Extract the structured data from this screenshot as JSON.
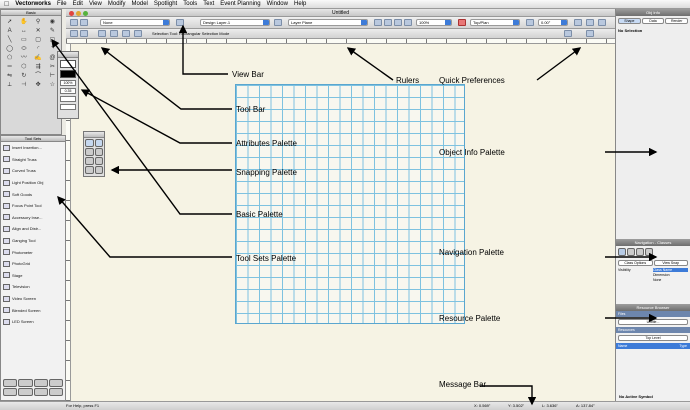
{
  "menubar": {
    "apple": "",
    "items": [
      "Vectorworks",
      "File",
      "Edit",
      "View",
      "Modify",
      "Model",
      "Spotlight",
      "Tools",
      "Text",
      "Event Planning",
      "Window",
      "Help"
    ]
  },
  "window": {
    "title": "Untitled"
  },
  "viewbar": {
    "layer_combo": "None",
    "design_layer": "Design Layer-1",
    "plane": "Layer Plane",
    "zoom": "100%",
    "view": "Top/Plan",
    "offset": "0.00°"
  },
  "modebar": {
    "status": "Selection Tool: Rectangular Selection Mode"
  },
  "basic_palette": {
    "title": "Basic"
  },
  "toolsets": {
    "title": "Tool Sets",
    "items": [
      "Insert Insertion...",
      "Straight Truss",
      "Curved Truss",
      "Light Position Obj",
      "Soft Goods",
      "Focus Point Tool",
      "Accessory Inse...",
      "Align and Distr...",
      "Ganging Tool",
      "Photometer",
      "PhotoGrid",
      "Stage",
      "Television",
      "Video Screen",
      "Blended Screen",
      "LED Screen"
    ]
  },
  "attributes": {
    "zoom": "100%",
    "value": "0.35"
  },
  "objinfo": {
    "title": "Obj Info",
    "tabs": [
      "Shape",
      "Data",
      "Render"
    ],
    "selection": "No Selection"
  },
  "navigation": {
    "title": "Navigation - Classes",
    "class_options": "Class Options",
    "view_snap": "View Snap",
    "cols": [
      "Visibility",
      "Class Name"
    ],
    "rows": [
      "Dimension",
      "None"
    ]
  },
  "resources": {
    "title": "Resource Browser",
    "files_label": "Files",
    "file_value": "Untitle...",
    "resources_label": "Resources",
    "level": "Top Level",
    "cols": [
      "Name",
      "Type"
    ],
    "active_symbol": "No Active Symbol"
  },
  "status": {
    "help": "For Help, press F1",
    "x": "X: 0.569\"",
    "y": "Y: 3.502\"",
    "l": "L: 3.636\"",
    "a": "A: 137.84°"
  },
  "annotations": {
    "view_bar": "View Bar",
    "rulers": "Rulers",
    "quick_pref": "Quick Preferences",
    "tool_bar": "Tool  Bar",
    "attributes": "Attributes Palette",
    "snapping": "Snapping Palette",
    "object_info": "Object Info Palette",
    "basic": "Basic  Palette",
    "tool_sets": "Tool Sets Palette",
    "navigation": "Navigation Palette",
    "resource": "Resource Palette",
    "message_bar": "Message Bar"
  },
  "colors": {
    "grid_line": "#7ec2e0",
    "drawing_bg": "#f6f3e4",
    "accent_blue": "#3d7bd8",
    "arrow": "#000000"
  }
}
